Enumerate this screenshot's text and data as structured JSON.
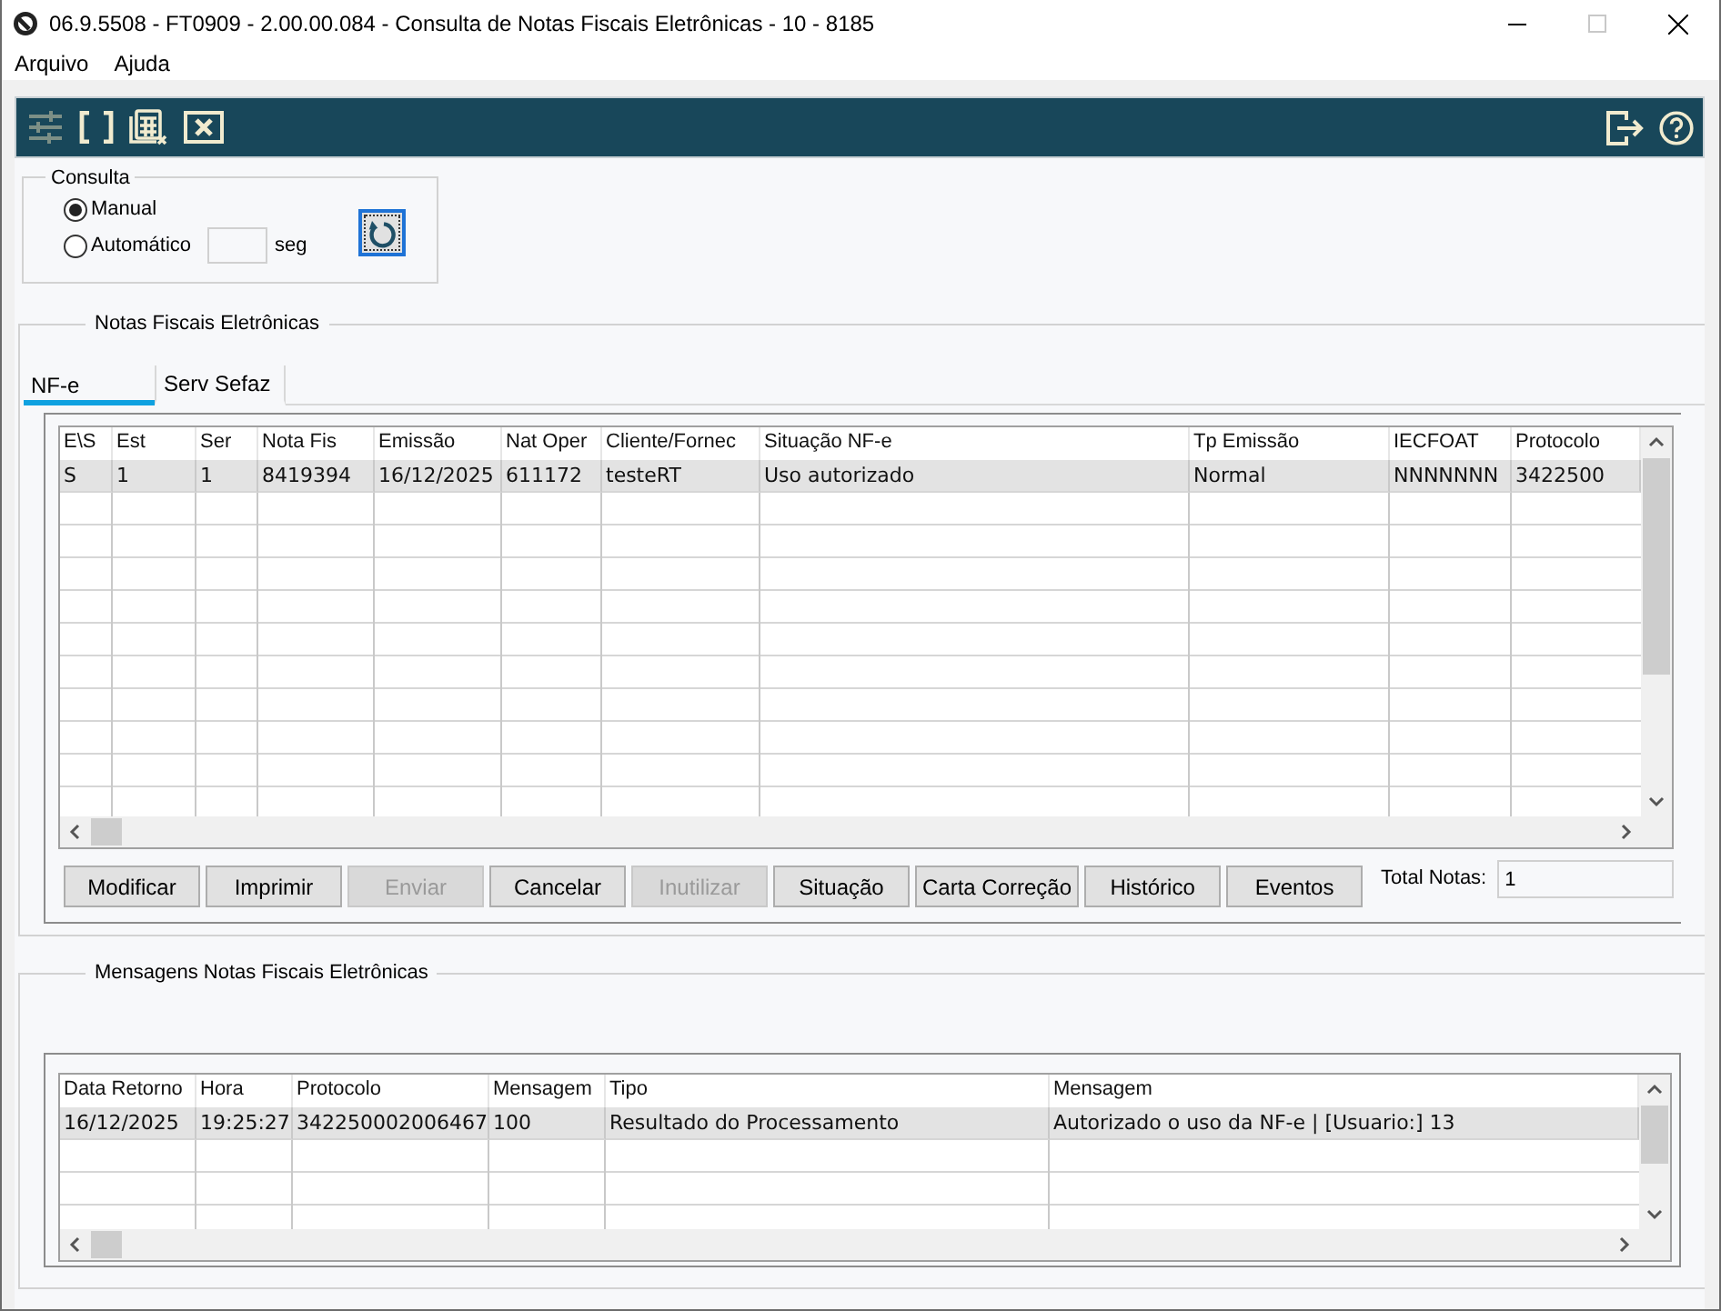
{
  "window": {
    "title": "06.9.5508 - FT0909 - 2.00.00.084 - Consulta de Notas Fiscais Eletrônicas - 10 - 8185"
  },
  "menu": [
    "Arquivo",
    "Ajuda"
  ],
  "toolbar": {
    "left": [
      {
        "kind": "sliders",
        "disabled": true
      },
      {
        "kind": "brackets",
        "disabled": false
      },
      {
        "kind": "calculator",
        "disabled": false
      },
      {
        "kind": "close-box",
        "disabled": false
      }
    ],
    "right": [
      {
        "kind": "exit",
        "disabled": false
      },
      {
        "kind": "help",
        "disabled": false
      }
    ]
  },
  "consulta": {
    "title": "Consulta",
    "modes": [
      {
        "label": "Manual",
        "selected": true
      },
      {
        "label": "Automático",
        "selected": false
      }
    ],
    "interval_unit": "seg"
  },
  "notas": {
    "title": "Notas Fiscais Eletrônicas",
    "tabs": [
      {
        "label": "NF-e",
        "selected": true
      },
      {
        "label": "Serv Sefaz",
        "selected": false
      }
    ],
    "table": {
      "columns": [
        "E\\S",
        "Est",
        "Ser",
        "Nota Fis",
        "Emissão",
        "Nat Oper",
        "Cliente/Fornec",
        "Situação NF-e",
        "Tp Emissão",
        "IECFOAT",
        "Protocolo"
      ],
      "rows": [
        {
          "cells": [
            "S",
            "1",
            "1",
            "8419394",
            "16/12/2025",
            "611172",
            "testeRT",
            "Uso autorizado",
            "Normal",
            "NNNNNNN",
            "3422500"
          ],
          "selected": true
        }
      ]
    },
    "buttons": [
      {
        "label": "Modificar",
        "disabled": false
      },
      {
        "label": "Imprimir",
        "disabled": false
      },
      {
        "label": "Enviar",
        "disabled": true
      },
      {
        "label": "Cancelar",
        "disabled": false
      },
      {
        "label": "Inutilizar",
        "disabled": true
      },
      {
        "label": "Situação",
        "disabled": false
      },
      {
        "label": "Carta Correção",
        "disabled": false
      },
      {
        "label": "Histórico",
        "disabled": false
      },
      {
        "label": "Eventos",
        "disabled": false
      }
    ],
    "total": {
      "label": "Total Notas:",
      "value": "1"
    }
  },
  "mensagens": {
    "title": "Mensagens Notas Fiscais Eletrônicas",
    "table": {
      "columns": [
        "Data Retorno",
        "Hora",
        "Protocolo",
        "Mensagem",
        "Tipo",
        "Mensagem"
      ],
      "rows": [
        {
          "cells": [
            "16/12/2025",
            "19:25:27",
            "342250002006467",
            "100",
            "Resultado do Processamento",
            "Autorizado o uso da NF-e | [Usuario:] 13"
          ],
          "selected": true
        }
      ]
    }
  }
}
